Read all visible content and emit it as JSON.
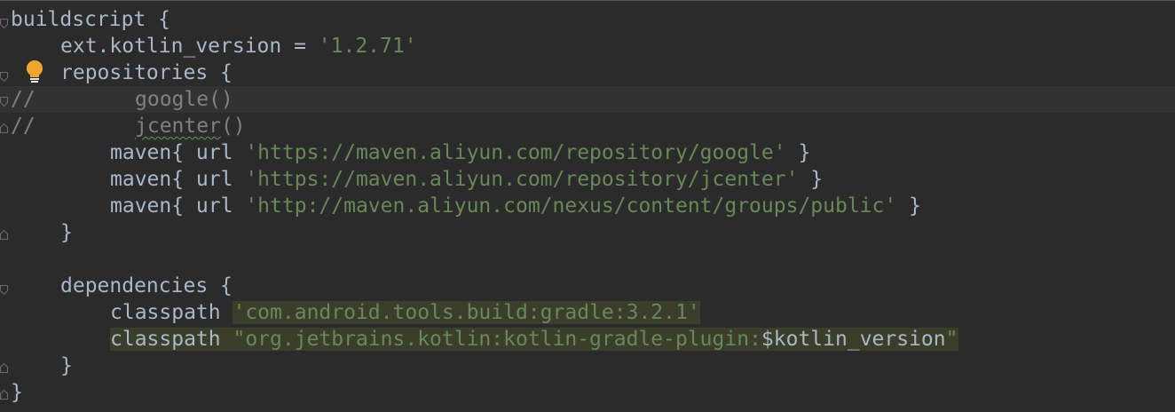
{
  "editor": {
    "lines": [
      {
        "segments": [
          {
            "text": "buildscript {",
            "kind": "plain"
          }
        ]
      },
      {
        "segments": [
          {
            "text": "ext.kotlin_version = ",
            "kind": "plain"
          },
          {
            "text": "'1.2.71'",
            "kind": "str"
          }
        ]
      },
      {
        "segments": [
          {
            "text": "repositories {",
            "kind": "plain"
          }
        ]
      },
      {
        "comment_marker": "//",
        "segments": [
          {
            "text": "google()",
            "kind": "comment"
          }
        ]
      },
      {
        "comment_marker": "//",
        "segments": [
          {
            "text": "jcenter",
            "kind": "comment-squiggle"
          },
          {
            "text": "()",
            "kind": "comment"
          }
        ]
      },
      {
        "segments": [
          {
            "text": "maven{ url ",
            "kind": "plain"
          },
          {
            "text": "'https://maven.aliyun.com/repository/google'",
            "kind": "str"
          },
          {
            "text": " }",
            "kind": "plain"
          }
        ]
      },
      {
        "segments": [
          {
            "text": "maven{ url ",
            "kind": "plain"
          },
          {
            "text": "'https://maven.aliyun.com/repository/jcenter'",
            "kind": "str"
          },
          {
            "text": " }",
            "kind": "plain"
          }
        ]
      },
      {
        "segments": [
          {
            "text": "maven{ url ",
            "kind": "plain"
          },
          {
            "text": "'http://maven.aliyun.com/nexus/content/groups/public'",
            "kind": "str"
          },
          {
            "text": " }",
            "kind": "plain"
          }
        ]
      },
      {
        "segments": [
          {
            "text": "}",
            "kind": "plain"
          }
        ]
      },
      {
        "segments": []
      },
      {
        "segments": [
          {
            "text": "dependencies {",
            "kind": "plain"
          }
        ]
      },
      {
        "segments": [
          {
            "text": "classpath ",
            "kind": "plain"
          },
          {
            "text": "'com.android.tools.build:gradle:3.2.1'",
            "kind": "str-hl"
          }
        ]
      },
      {
        "segments": [
          {
            "text": "classpath ",
            "kind": "plain-hl"
          },
          {
            "text": "\"org.jetbrains.kotlin:kotlin-gradle-plugin:",
            "kind": "str-hl"
          },
          {
            "text": "$kotlin_version",
            "kind": "plain-hl"
          },
          {
            "text": "\"",
            "kind": "str-hl"
          }
        ]
      },
      {
        "segments": [
          {
            "text": "}",
            "kind": "plain"
          }
        ]
      },
      {
        "segments": [
          {
            "text": "}",
            "kind": "plain"
          }
        ]
      }
    ],
    "current_line": 4,
    "intention_icon": "lightbulb-icon",
    "fold_icon": "fold-marker-icon",
    "colors": {
      "background": "#2b2b2b",
      "text": "#a9b7c6",
      "string": "#6a8759",
      "comment": "#808080",
      "highlight": "#3b3e2b",
      "current_line": "#323232",
      "bulb": "#f0a732"
    }
  }
}
